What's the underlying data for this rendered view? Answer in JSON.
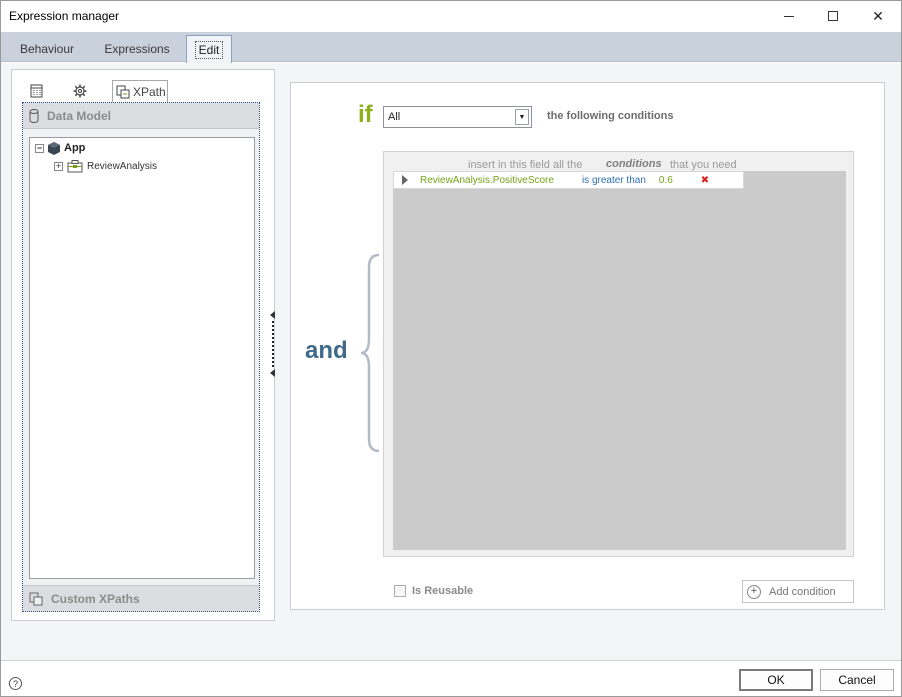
{
  "window": {
    "title": "Expression manager"
  },
  "tabs": [
    {
      "label": "Behaviour"
    },
    {
      "label": "Expressions"
    },
    {
      "label": "Edit"
    }
  ],
  "left_panel": {
    "tabs": [
      {
        "icon": "table-icon"
      },
      {
        "icon": "gear-icon"
      },
      {
        "icon": "xpath-icon",
        "label": "XPath"
      }
    ],
    "data_model_header": "Data Model",
    "tree": {
      "root": {
        "label": "App",
        "expander": "⊟"
      },
      "child": {
        "label": "ReviewAnalysis",
        "expander": "⊞"
      }
    },
    "custom_xpaths_header": "Custom XPaths"
  },
  "right_panel": {
    "if_label": "if",
    "quantifier": {
      "selected": "All"
    },
    "following_label": "the following conditions",
    "and_label": "and",
    "hint": {
      "part1": "insert in this field all the",
      "part2": "conditions",
      "part3": "that you need"
    },
    "conditions": [
      {
        "field": "ReviewAnalysis.PositiveScore",
        "operator": "is greater than",
        "value": "0.6"
      }
    ],
    "reusable_label": "Is Reusable",
    "add_condition_label": "Add condition"
  },
  "footer": {
    "help": "?",
    "ok_label": "OK",
    "cancel_label": "Cancel"
  }
}
